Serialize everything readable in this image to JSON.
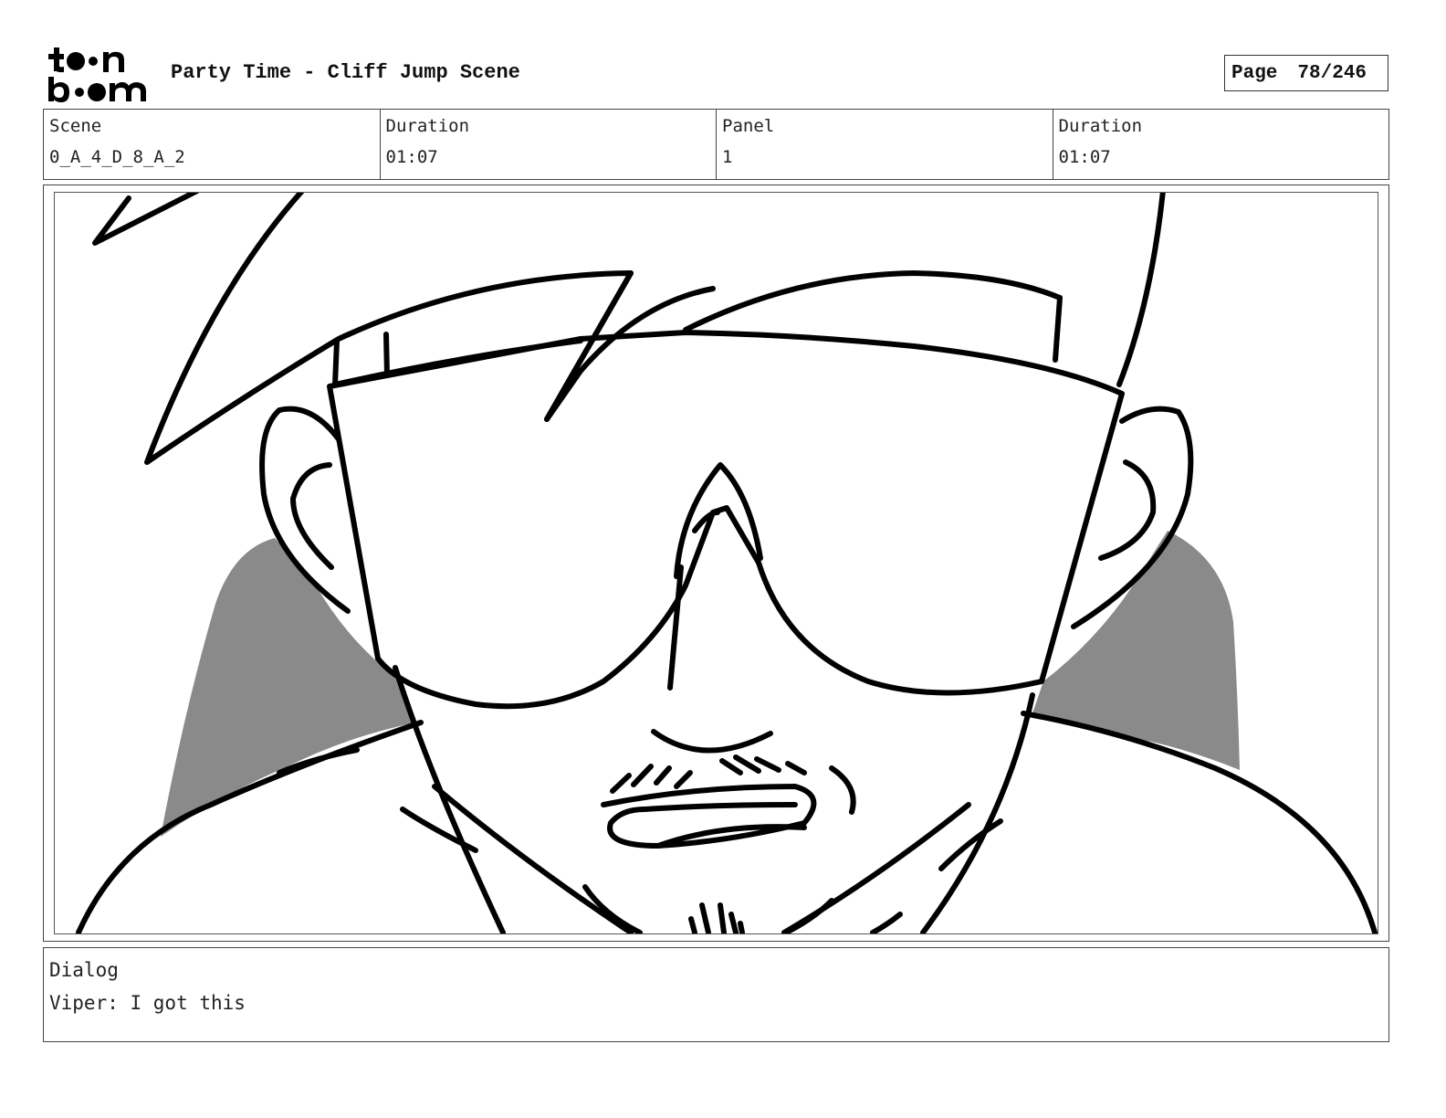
{
  "header": {
    "logo_text": "toon boom",
    "title": "Party Time - Cliff Jump Scene",
    "page_label": "Page",
    "page_number": "78/246"
  },
  "info": {
    "scene_label": "Scene",
    "scene_value": "0_A_4_D_8_A_2",
    "scene_duration_label": "Duration",
    "scene_duration_value": "01:07",
    "panel_label": "Panel",
    "panel_value": "1",
    "panel_duration_label": "Duration",
    "panel_duration_value": "01:07"
  },
  "dialog": {
    "label": "Dialog",
    "text": "Viper: I got this"
  },
  "colors": {
    "shading": "#8a8a8a",
    "ink": "#000000"
  }
}
